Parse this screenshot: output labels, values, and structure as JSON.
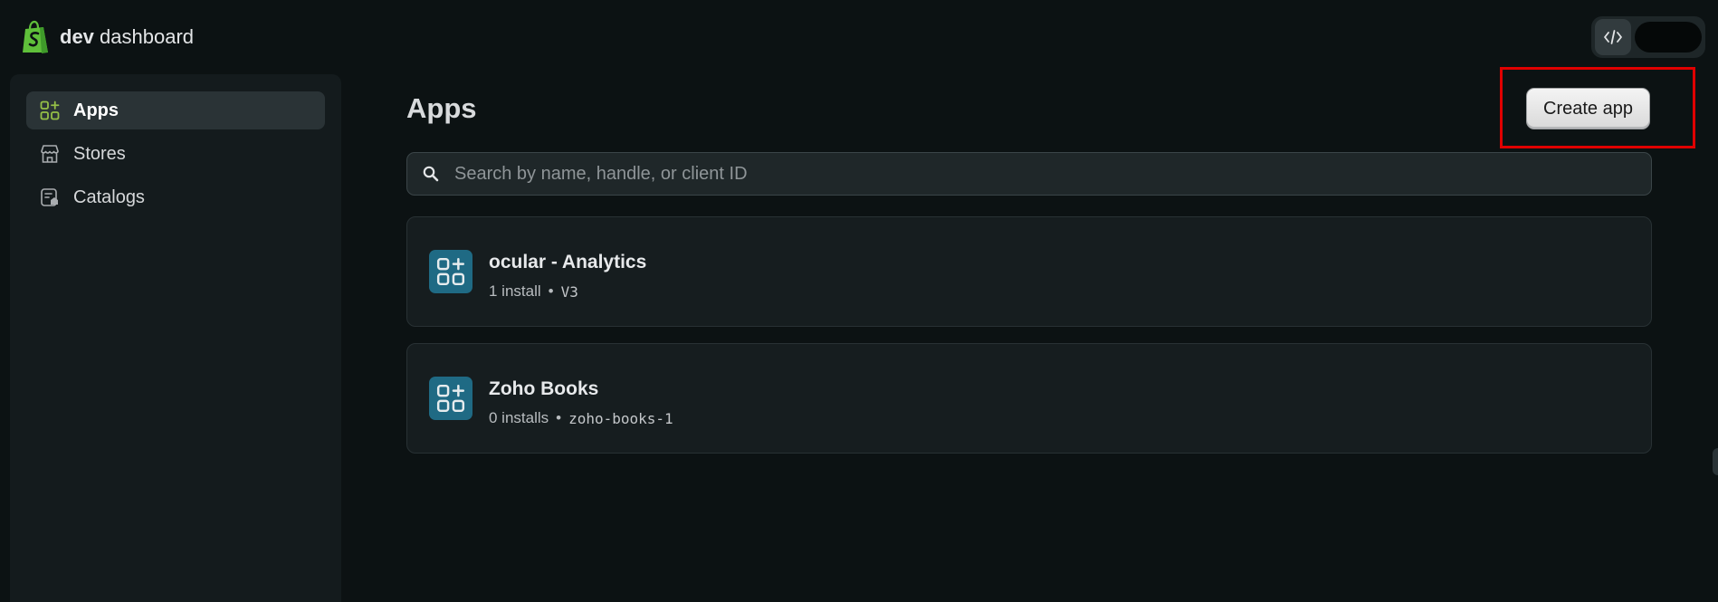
{
  "brand": {
    "bold": "dev",
    "rest": " dashboard"
  },
  "sidebar": {
    "items": [
      {
        "label": "Apps",
        "icon": "apps-grid-plus-icon",
        "active": true
      },
      {
        "label": "Stores",
        "icon": "store-icon",
        "active": false
      },
      {
        "label": "Catalogs",
        "icon": "catalog-icon",
        "active": false
      }
    ]
  },
  "main": {
    "title": "Apps",
    "create_button": "Create app",
    "search": {
      "placeholder": "Search by name, handle, or client ID",
      "value": ""
    },
    "apps": [
      {
        "name": "ocular - Analytics",
        "installs": "1 install",
        "separator": "•",
        "handle": "V3"
      },
      {
        "name": "Zoho Books",
        "installs": "0 installs",
        "separator": "•",
        "handle": "zoho-books-1"
      }
    ]
  },
  "colors": {
    "accent_green": "#95bf47",
    "highlight_red": "#e00000",
    "app_icon_bg": "#1f6a84"
  }
}
